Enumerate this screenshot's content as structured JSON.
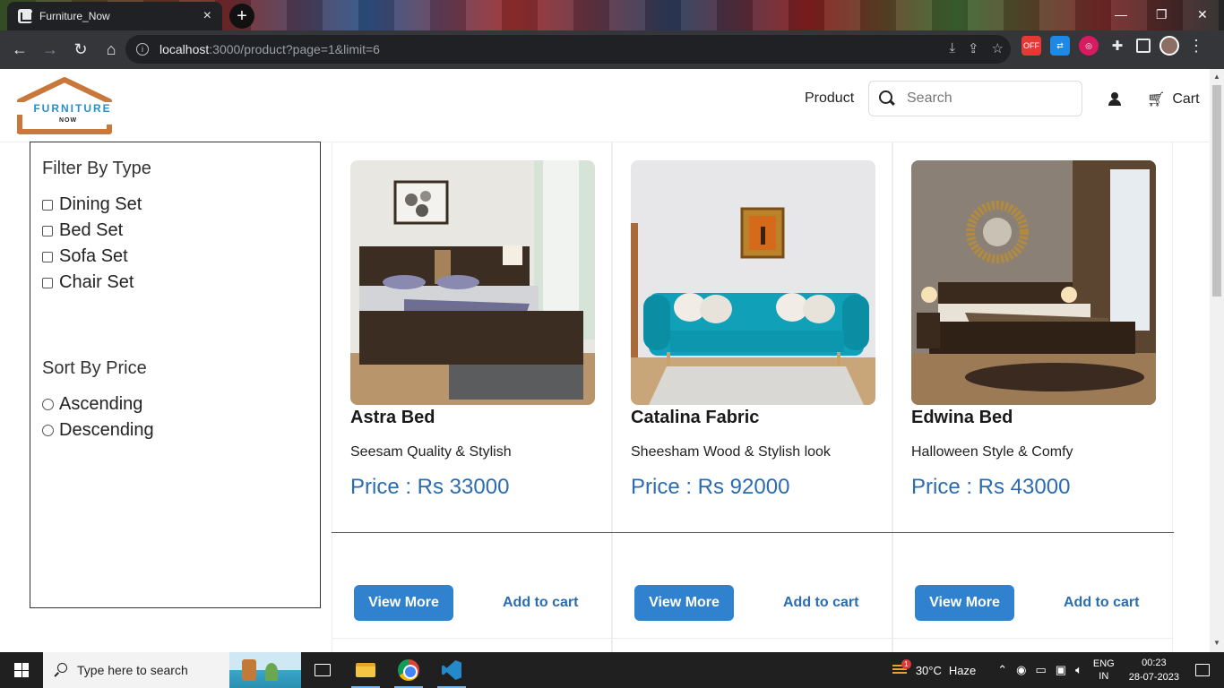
{
  "browser": {
    "tab_title": "Furniture_Now",
    "url_host": "localhost",
    "url_rest": ":3000/product?page=1&limit=6",
    "ext_badge": "OFF"
  },
  "header": {
    "logo_text": "FURNITURE",
    "logo_sub": "NOW",
    "nav_product": "Product",
    "search_placeholder": "Search",
    "cart_label": "Cart"
  },
  "sidebar": {
    "filter_title": "Filter By Type",
    "filter_options": [
      "Dining Set",
      "Bed Set",
      "Sofa Set",
      "Chair Set"
    ],
    "sort_title": "Sort By Price",
    "sort_options": [
      "Ascending",
      "Descending"
    ]
  },
  "products": [
    {
      "name": "Astra Bed",
      "description": "Seesam Quality & Stylish",
      "price": "Price : Rs 33000",
      "view_more": "View More",
      "add_to_cart": "Add to cart"
    },
    {
      "name": "Catalina Fabric",
      "description": "Sheesham Wood & Stylish look",
      "price": "Price : Rs 92000",
      "view_more": "View More",
      "add_to_cart": "Add to cart"
    },
    {
      "name": "Edwina Bed",
      "description": "Halloween Style & Comfy",
      "price": "Price : Rs 43000",
      "view_more": "View More",
      "add_to_cart": "Add to cart"
    }
  ],
  "taskbar": {
    "search_text": "Type here to search",
    "weather_temp": "30°C",
    "weather_desc": "Haze",
    "weather_badge": "1",
    "lang_1": "ENG",
    "lang_2": "IN",
    "time": "00:23",
    "date": "28-07-2023"
  },
  "colors": {
    "accent": "#3182ce",
    "price": "#2b6cb0",
    "logo_brown": "#c9773a",
    "logo_blue": "#2a8fc7"
  }
}
